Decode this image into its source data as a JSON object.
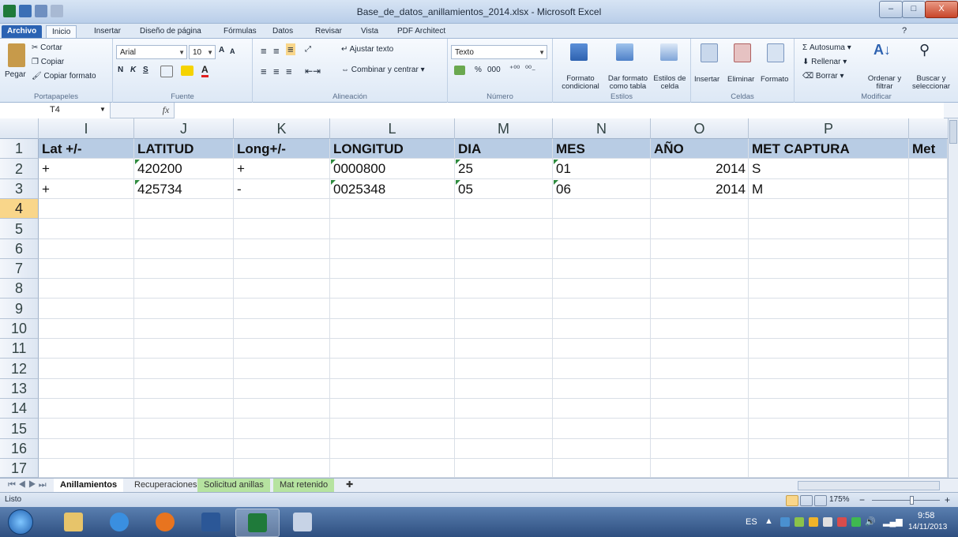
{
  "window": {
    "title": "Base_de_datos_anillamientos_2014.xlsx - Microsoft Excel",
    "min": "–",
    "max": "□",
    "close": "X"
  },
  "ribbon_tabs": [
    "Archivo",
    "Inicio",
    "Insertar",
    "Diseño de página",
    "Fórmulas",
    "Datos",
    "Revisar",
    "Vista",
    "PDF Architect"
  ],
  "ribbon": {
    "clipboard": {
      "paste": "Pegar",
      "cut": "Cortar",
      "copy": "Copiar",
      "format_painter": "Copiar formato",
      "label": "Portapapeles"
    },
    "font": {
      "name": "Arial",
      "size": "10",
      "bold": "N",
      "italic": "K",
      "underline": "S",
      "label": "Fuente"
    },
    "alignment": {
      "wrap": "Ajustar texto",
      "merge": "Combinar y centrar",
      "label": "Alineación"
    },
    "number": {
      "format": "Texto",
      "percent": "%",
      "thousands": "000",
      "label": "Número"
    },
    "styles": {
      "conditional": "Formato condicional",
      "table": "Dar formato como tabla",
      "cell": "Estilos de celda",
      "label": "Estilos"
    },
    "cells": {
      "insert": "Insertar",
      "delete": "Eliminar",
      "format": "Formato",
      "label": "Celdas"
    },
    "editing": {
      "autosum": "Autosuma",
      "fill": "Rellenar",
      "clear": "Borrar",
      "sort": "Ordenar y filtrar",
      "find": "Buscar y seleccionar",
      "label": "Modificar"
    }
  },
  "formula_bar": {
    "name_box": "T4",
    "fx": "fx",
    "value": ""
  },
  "columns": [
    "I",
    "J",
    "K",
    "L",
    "M",
    "N",
    "O",
    "P"
  ],
  "rows": [
    {
      "n": "1",
      "cells": [
        "Lat +/-",
        "LATITUD",
        "Long+/-",
        "LONGITUD",
        "DIA",
        "MES",
        "AÑO",
        "MET CAPTURA"
      ],
      "overflow": "Met"
    },
    {
      "n": "2",
      "cells": [
        "+",
        "420200",
        "+",
        "0000800",
        "25",
        "01",
        "2014",
        "S"
      ]
    },
    {
      "n": "3",
      "cells": [
        "+",
        "425734",
        "-",
        "0025348",
        "05",
        "06",
        "2014",
        "M"
      ]
    },
    {
      "n": "4"
    },
    {
      "n": "5"
    },
    {
      "n": "6"
    },
    {
      "n": "7"
    },
    {
      "n": "8"
    },
    {
      "n": "9"
    },
    {
      "n": "10"
    },
    {
      "n": "11"
    },
    {
      "n": "12"
    },
    {
      "n": "13"
    },
    {
      "n": "14"
    },
    {
      "n": "15"
    },
    {
      "n": "16"
    },
    {
      "n": "17"
    }
  ],
  "sheets": [
    "Anillamientos",
    "Recuperaciones",
    "Solicitud anillas",
    "Mat retenido"
  ],
  "status": {
    "text": "Listo",
    "zoom": "175%",
    "minus": "−",
    "plus": "+"
  },
  "taskbar": {
    "lang": "ES",
    "time": "9:58",
    "date": "14/11/2013"
  }
}
